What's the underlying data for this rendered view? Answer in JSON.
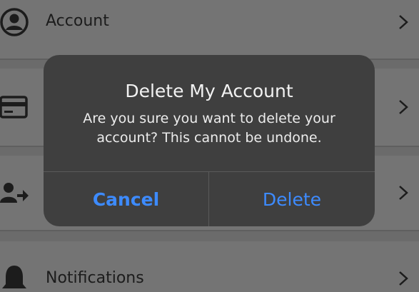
{
  "settings": {
    "items": [
      {
        "label": "Account",
        "icon": "user-circle-icon"
      },
      {
        "label": "",
        "icon": "credit-card-icon"
      },
      {
        "label": "",
        "icon": "user-transfer-icon"
      },
      {
        "label": "Notifications",
        "icon": "bell-icon"
      }
    ]
  },
  "dialog": {
    "title": "Delete My Account",
    "message": "Are you sure you want to delete your account? This cannot be undone.",
    "cancel_label": "Cancel",
    "delete_label": "Delete"
  },
  "colors": {
    "accent": "#3d8bff",
    "dialog_bg": "#3f3f3f",
    "dimmed_bg": "#6f6f6f"
  }
}
